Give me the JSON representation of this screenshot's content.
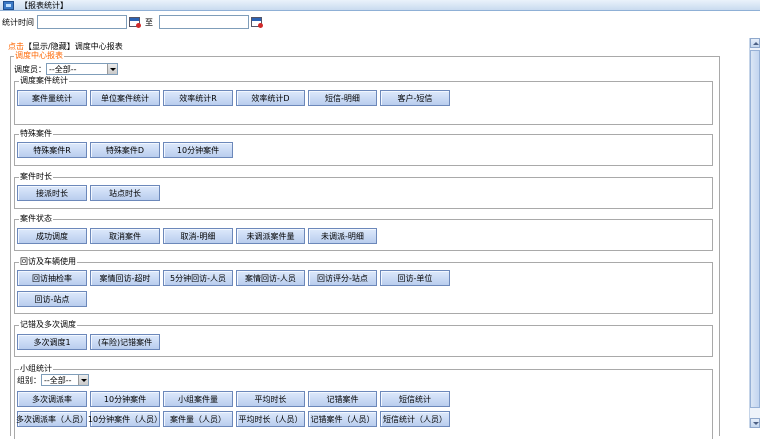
{
  "window": {
    "title": "【报表统计】"
  },
  "filter": {
    "time_label": "统计时间",
    "to_label": "至",
    "start_value": "",
    "end_value": ""
  },
  "toggle": {
    "click_text": "点击",
    "rest_text": "【显示/隐藏】调度中心报表"
  },
  "panel": {
    "legend": "调度中心报表",
    "dispatcher_label": "调度员：",
    "dispatcher_value": "--全部--",
    "groups": {
      "case_stats": {
        "legend": "调度案件统计",
        "buttons": [
          "案件量统计",
          "单位案件统计",
          "效率统计R",
          "效率统计D",
          "短信-明细",
          "客户-短信"
        ]
      },
      "special": {
        "legend": "特殊案件",
        "buttons": [
          "特殊案件R",
          "特殊案件D",
          "10分钟案件"
        ]
      },
      "duration": {
        "legend": "案件时长",
        "buttons": [
          "接派时长",
          "站点时长"
        ]
      },
      "status": {
        "legend": "案件状态",
        "buttons": [
          "成功调度",
          "取消案件",
          "取消-明细",
          "未调派案件量",
          "未调派-明细"
        ]
      },
      "revisit": {
        "legend": "回访及车辆使用",
        "buttons": [
          "回访抽检率",
          "案情回访-超时",
          "5分钟回访-人员",
          "案情回访-人员",
          "回访评分-站点",
          "回访-单位",
          "回访-站点"
        ]
      },
      "records": {
        "legend": "记错及多次调度",
        "buttons": [
          "多次调度1",
          "(车险)记错案件"
        ]
      },
      "team": {
        "legend": "小组统计",
        "group_label": "组别：",
        "group_value": "--全部--",
        "row1": [
          "多次调派率",
          "10分钟案件",
          "小组案件量",
          "平均时长",
          "记错案件",
          "短信统计"
        ],
        "row2": [
          "多次调派率（人员）",
          "10分钟案件（人员）",
          "案件量（人员）",
          "平均时长（人员）",
          "记错案件（人员）",
          "短信统计（人员）"
        ]
      }
    }
  },
  "icons": {
    "app": "report-window-icon",
    "calendar": "calendar-icon"
  }
}
